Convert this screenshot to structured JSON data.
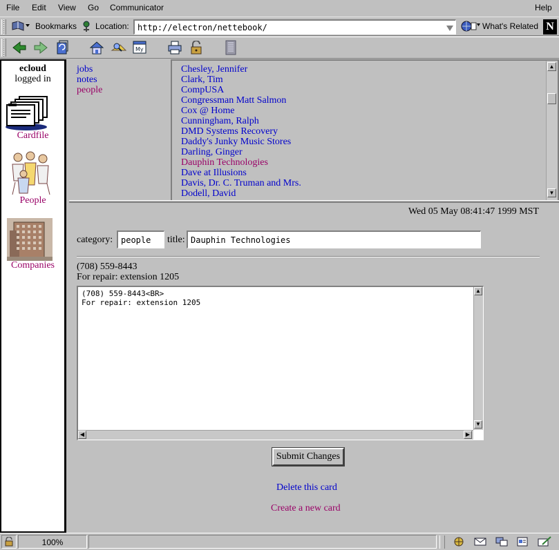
{
  "menu": {
    "file": "File",
    "edit": "Edit",
    "view": "View",
    "go": "Go",
    "communicator": "Communicator",
    "help": "Help"
  },
  "location_bar": {
    "bookmarks_label": "Bookmarks",
    "location_label": "Location:",
    "url": "http://electron/nettebook/",
    "whats_related": "What's Related",
    "netscape_logo": "N"
  },
  "toolbar": {
    "icons": [
      "back-icon",
      "forward-icon",
      "reload-icon",
      "home-icon",
      "search-icon",
      "my-netscape-icon",
      "print-icon",
      "security-icon",
      "stop-icon"
    ],
    "my_label": "My"
  },
  "sidebar": {
    "user": "ecloud",
    "status": "logged in",
    "items": [
      {
        "label": "Cardfile",
        "icon": "cardfile-icon"
      },
      {
        "label": "People",
        "icon": "people-icon"
      },
      {
        "label": "Companies",
        "icon": "companies-icon"
      }
    ]
  },
  "nav": {
    "links": [
      {
        "label": "jobs",
        "visited": false
      },
      {
        "label": "notes",
        "visited": false
      },
      {
        "label": "people",
        "visited": true
      }
    ]
  },
  "card_list": {
    "items": [
      {
        "label": "Chesley, Jennifer",
        "selected": false
      },
      {
        "label": "Clark, Tim",
        "selected": false
      },
      {
        "label": "CompUSA",
        "selected": false
      },
      {
        "label": "Congressman Matt Salmon",
        "selected": false
      },
      {
        "label": "Cox @ Home",
        "selected": false
      },
      {
        "label": "Cunningham, Ralph",
        "selected": false
      },
      {
        "label": "DMD Systems Recovery",
        "selected": false
      },
      {
        "label": "Daddy's Junky Music Stores",
        "selected": false
      },
      {
        "label": "Darling, Ginger",
        "selected": false
      },
      {
        "label": "Dauphin Technologies",
        "selected": true
      },
      {
        "label": "Dave at Illusions",
        "selected": false
      },
      {
        "label": "Davis, Dr. C. Truman and Mrs.",
        "selected": false
      },
      {
        "label": "Dodell, David",
        "selected": false
      }
    ]
  },
  "card": {
    "timestamp": "Wed 05 May 08:41:47 1999 MST",
    "category_label": "category:",
    "category_value": "people",
    "title_label": "title:",
    "title_value": "Dauphin Technologies",
    "preview_line1": "(708) 559-8443",
    "preview_line2": "For repair: extension 1205",
    "body_text": "(708) 559-8443<BR>\nFor repair: extension 1205",
    "submit_label": "Submit Changes",
    "delete_label": "Delete this card",
    "create_label": "Create a new card"
  },
  "status_bar": {
    "zoom": "100%"
  },
  "colors": {
    "chrome": "#c0c0c0",
    "link": "#0000cc",
    "visited_link": "#990066"
  }
}
